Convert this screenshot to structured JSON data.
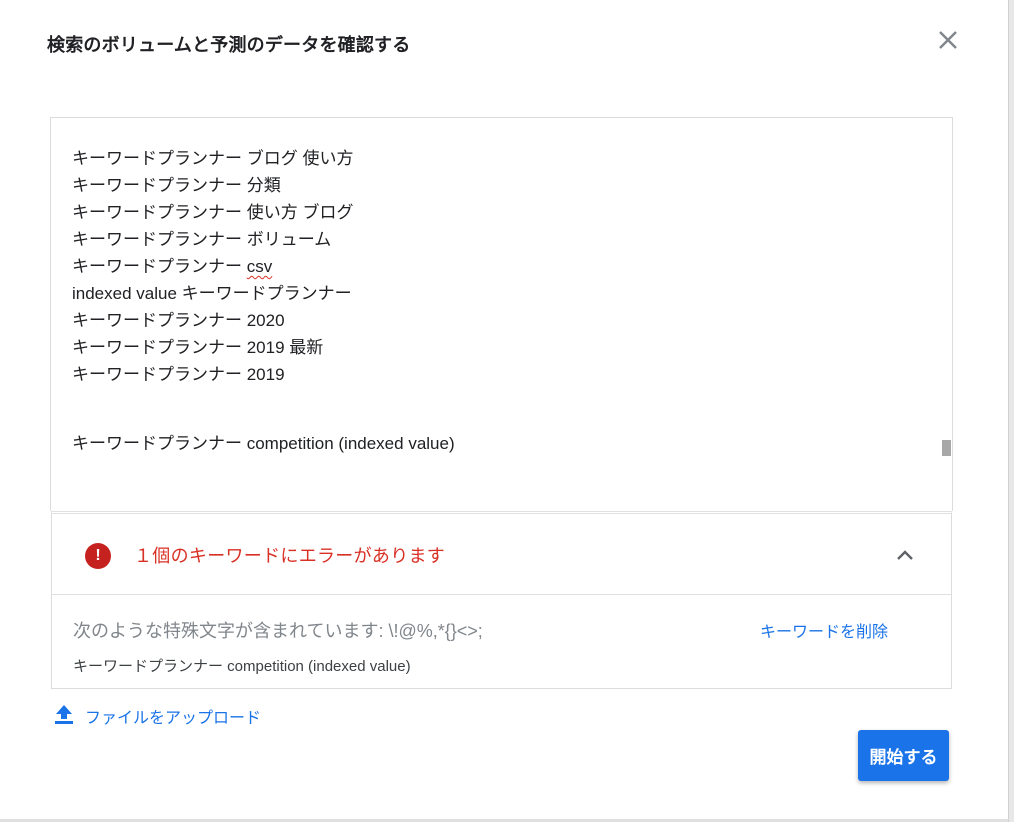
{
  "dialog": {
    "title": "検索のボリュームと予測のデータを確認する",
    "close_icon": "close-icon"
  },
  "keywords": {
    "lines": [
      "キーワードプランナー ブログ 使い方",
      "キーワードプランナー 分類",
      "キーワードプランナー 使い方 ブログ",
      "キーワードプランナー ボリューム",
      "キーワードプランナー ",
      "indexed value キーワードプランナー",
      "キーワードプランナー 2020",
      "キーワードプランナー 2019 最新",
      "キーワードプランナー 2019",
      "",
      "キーワードプランナー competition (indexed value)"
    ],
    "spell_word": "csv"
  },
  "error": {
    "summary": "１個のキーワードにエラーがあります",
    "icon": "error-icon",
    "detail": "次のような特殊文字が含まれています: \\!@%,*{}<>;",
    "remove_label": "キーワードを削除",
    "bad_keyword": "キーワードプランナー competition (indexed value)"
  },
  "upload": {
    "label": "ファイルをアップロード",
    "icon": "upload-icon"
  },
  "actions": {
    "start_label": "開始する"
  },
  "colors": {
    "accent": "#1a73e8",
    "error": "#d93025"
  }
}
